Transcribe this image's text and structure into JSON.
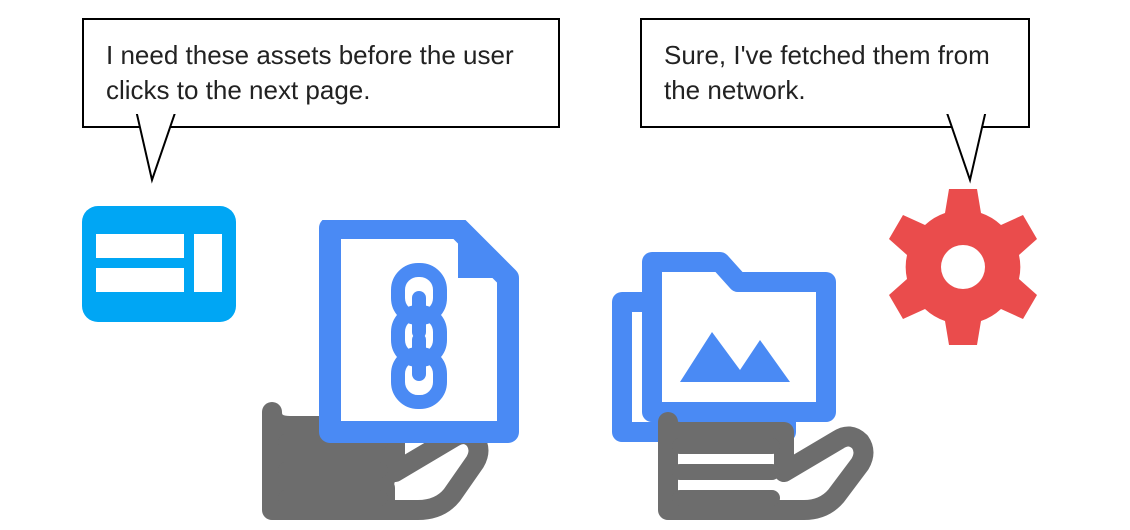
{
  "bubbles": {
    "left": "I need these assets before the user clicks to the next page.",
    "right": "Sure, I've fetched them from the network."
  },
  "colors": {
    "cyan": "#00a6f4",
    "blue": "#4a8af4",
    "red": "#ea4c4c",
    "gray": "#6d6d6d",
    "white": "#ffffff",
    "border": "#000000"
  },
  "icons": {
    "webpage": "webpage-layout-icon",
    "document": "document-chain-icon",
    "hand_left": "pointing-hand-icon",
    "folder": "folder-image-icon",
    "hand_right": "pointing-hand-icon",
    "gear": "gear-icon"
  }
}
